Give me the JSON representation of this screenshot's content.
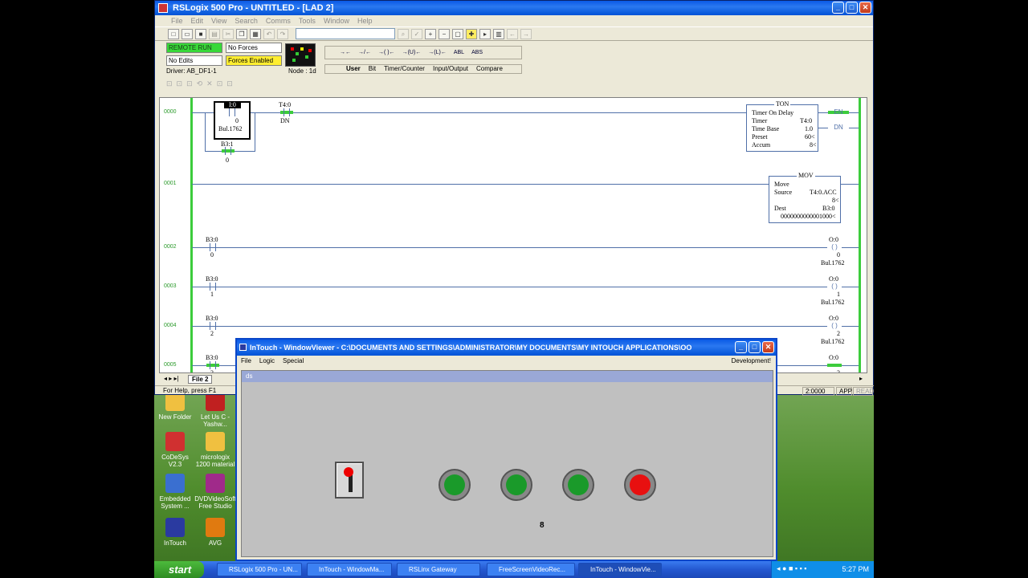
{
  "rslogix": {
    "title": "RSLogix 500 Pro - UNTITLED - [LAD 2]",
    "menu": [
      "File",
      "Edit",
      "View",
      "Search",
      "Comms",
      "Tools",
      "Window",
      "Help"
    ],
    "status": {
      "mode": "REMOTE RUN",
      "forces": "No Forces",
      "edits": "No Edits",
      "forces_enabled": "Forces Enabled",
      "driver": "Driver: AB_DF1-1",
      "node": "Node : 1d"
    },
    "instr_tabs": [
      "User",
      "Bit",
      "Timer/Counter",
      "Input/Output",
      "Compare"
    ],
    "instr_icons": [
      "→←",
      "→/←",
      "→( )←",
      "→(U)←",
      "→(L)←",
      "ABL",
      "ABS"
    ],
    "ladder": {
      "rungs": [
        "0000",
        "0001",
        "0002",
        "0003",
        "0004",
        "0005"
      ],
      "r0": {
        "in_tag": "I:0",
        "in_bit": "0",
        "in_desc": "Bul.1762",
        "branch_tag": "B3:1",
        "branch_bit": "0",
        "t_tag": "T4:0",
        "t_bit": "DN",
        "ton": {
          "name": "TON",
          "l1": "Timer On Delay",
          "timer_label": "Timer",
          "timer": "T4:0",
          "tb_label": "Time Base",
          "tb": "1.0",
          "preset_label": "Preset",
          "preset": "60<",
          "accum_label": "Accum",
          "accum": "8<",
          "en": "EN",
          "dn": "DN"
        }
      },
      "r1": {
        "mov": {
          "name": "MOV",
          "l1": "Move",
          "src_label": "Source",
          "src": "T4:0.ACC",
          "src_val": "8<",
          "dest_label": "Dest",
          "dest": "B3:0",
          "dest_val": "0000000000001000<"
        }
      },
      "r2": {
        "in_tag": "B3:0",
        "in_bit": "0",
        "out_tag": "O:0",
        "out_bit": "0",
        "out_desc": "Bul.1762"
      },
      "r3": {
        "in_tag": "B3:0",
        "in_bit": "1",
        "out_tag": "O:0",
        "out_bit": "1",
        "out_desc": "Bul.1762"
      },
      "r4": {
        "in_tag": "B3:0",
        "in_bit": "2",
        "out_tag": "O:0",
        "out_bit": "2",
        "out_desc": "Bul.1762"
      },
      "r5": {
        "in_tag": "B3:0",
        "in_bit": "3",
        "out_tag": "O:0",
        "out_bit": "3"
      }
    },
    "file_tab": "File 2",
    "help": "For Help, press F1",
    "addr": "2:0000",
    "app": "APP",
    "read": "READ"
  },
  "desktop": {
    "icons": [
      {
        "label": "New Folder",
        "color": "#f0c040"
      },
      {
        "label": "Let Us C - Yashw...",
        "color": "#c02020"
      },
      {
        "label": "CoDeSys V2.3",
        "color": "#d03030"
      },
      {
        "label": "micrologix 1200 material",
        "color": "#f0c040"
      },
      {
        "label": "Embedded System ...",
        "color": "#3a6fd0"
      },
      {
        "label": "DVDVideoSoft Free Studio",
        "color": "#a02a8a"
      },
      {
        "label": "InTouch",
        "color": "#2a3aa0"
      },
      {
        "label": "AVG",
        "color": "#e07a10"
      }
    ]
  },
  "intouch": {
    "title": "InTouch - WindowViewer - C:\\DOCUMENTS AND SETTINGS\\ADMINISTRATOR\\MY DOCUMENTS\\MY INTOUCH APPLICATIONS\\OO",
    "menu": [
      "File",
      "Logic",
      "Special"
    ],
    "dev": "Development!",
    "window_name": "ds",
    "lamps": [
      "#1a9a2a",
      "#1a9a2a",
      "#1a9a2a",
      "#e81010"
    ],
    "counter": "8"
  },
  "taskbar": {
    "start": "start",
    "tasks": [
      "RSLogix 500 Pro - UN...",
      "InTouch - WindowMa...",
      "RSLinx Gateway",
      "FreeScreenVideoRec...",
      "InTouch - WindowVie..."
    ],
    "clock": "5:27 PM"
  }
}
